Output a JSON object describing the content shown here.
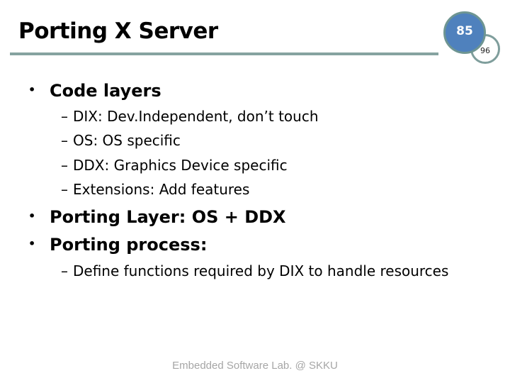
{
  "slide": {
    "title": "Porting X Server",
    "page_number": "85",
    "secondary_number": "96",
    "accent_colors": {
      "circle_fill": "#4f81bd",
      "rule": "#86a3a0"
    },
    "bullets": [
      {
        "marker": "•",
        "text": "Code layers",
        "sub": [
          {
            "marker": "–",
            "text": "DIX: Dev.Independent, don’t touch"
          },
          {
            "marker": "–",
            "text": "OS: OS specific"
          },
          {
            "marker": "–",
            "text": "DDX: Graphics Device specific"
          },
          {
            "marker": "–",
            "text": "Extensions: Add features"
          }
        ]
      },
      {
        "marker": "•",
        "text": "Porting Layer: OS + DDX",
        "sub": []
      },
      {
        "marker": "•",
        "text": "Porting process:",
        "sub": [
          {
            "marker": "–",
            "text": "Define functions required by DIX to handle resources"
          }
        ]
      }
    ],
    "footer": "Embedded Software Lab. @ SKKU"
  }
}
